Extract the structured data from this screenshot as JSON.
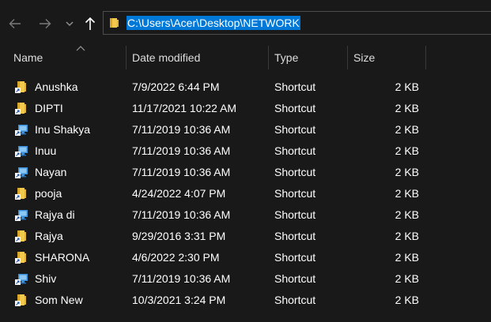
{
  "address_bar": {
    "path": "C:\\Users\\Acer\\Desktop\\NETWORK"
  },
  "nav": {
    "back_icon": "arrow-left-icon",
    "forward_icon": "arrow-right-icon",
    "recent_icon": "chevron-down-icon",
    "up_icon": "arrow-up-icon"
  },
  "columns": {
    "name": "Name",
    "date_modified": "Date modified",
    "type": "Type",
    "size": "Size"
  },
  "files": [
    {
      "name": "Anushka",
      "date": "7/9/2022 6:44 PM",
      "type": "Shortcut",
      "size": "2 KB",
      "icon": "folder-shortcut-icon"
    },
    {
      "name": "DIPTI",
      "date": "11/17/2021 10:22 AM",
      "type": "Shortcut",
      "size": "2 KB",
      "icon": "folder-shortcut-icon"
    },
    {
      "name": "Inu Shakya",
      "date": "7/11/2019 10:36 AM",
      "type": "Shortcut",
      "size": "2 KB",
      "icon": "network-shortcut-icon"
    },
    {
      "name": "Inuu",
      "date": "7/11/2019 10:36 AM",
      "type": "Shortcut",
      "size": "2 KB",
      "icon": "network-shortcut-icon"
    },
    {
      "name": "Nayan",
      "date": "7/11/2019 10:36 AM",
      "type": "Shortcut",
      "size": "2 KB",
      "icon": "network-shortcut-icon"
    },
    {
      "name": "pooja",
      "date": "4/24/2022 4:07 PM",
      "type": "Shortcut",
      "size": "2 KB",
      "icon": "folder-shortcut-icon"
    },
    {
      "name": "Rajya di",
      "date": "7/11/2019 10:36 AM",
      "type": "Shortcut",
      "size": "2 KB",
      "icon": "network-shortcut-icon"
    },
    {
      "name": "Rajya",
      "date": "9/29/2016 3:31 PM",
      "type": "Shortcut",
      "size": "2 KB",
      "icon": "folder-shortcut-icon"
    },
    {
      "name": "SHARONA",
      "date": "4/6/2022 2:30 PM",
      "type": "Shortcut",
      "size": "2 KB",
      "icon": "folder-shortcut-icon"
    },
    {
      "name": "Shiv",
      "date": "7/11/2019 10:36 AM",
      "type": "Shortcut",
      "size": "2 KB",
      "icon": "network-shortcut-icon"
    },
    {
      "name": "Som New",
      "date": "10/3/2021 3:24 PM",
      "type": "Shortcut",
      "size": "2 KB",
      "icon": "folder-shortcut-icon"
    }
  ],
  "colors": {
    "background": "#191919",
    "selection": "#0078d7",
    "folder": "#f2c94c",
    "network": "#3b8fd6"
  }
}
